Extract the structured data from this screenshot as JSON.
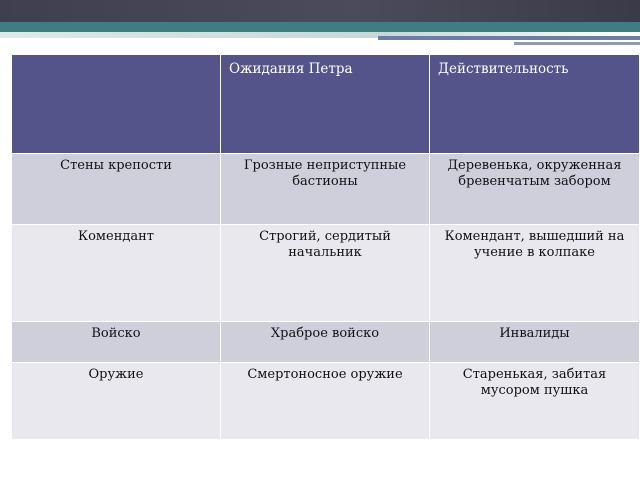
{
  "table": {
    "headers": [
      "",
      "Ожидания Петра",
      "Действительность"
    ],
    "rows": [
      [
        "Стены крепости",
        "Грозные неприступные бастионы",
        "Деревенька, окруженная бревенчатым забором"
      ],
      [
        "Комендант",
        "Строгий, сердитый начальник",
        "Комендант, вышедший на учение в колпаке"
      ],
      [
        "Войско",
        "Храброе войско",
        "Инвалиды"
      ],
      [
        "Оружие",
        "Смертоносное оружие",
        "Старенькая, забитая мусором пушка"
      ]
    ]
  },
  "colors": {
    "header_bg": "#54538a",
    "row_dark": "#cfcfdc",
    "row_light": "#e8e8ee",
    "band_dark": "#3f3f4f",
    "band_teal": "#3f7d83"
  }
}
